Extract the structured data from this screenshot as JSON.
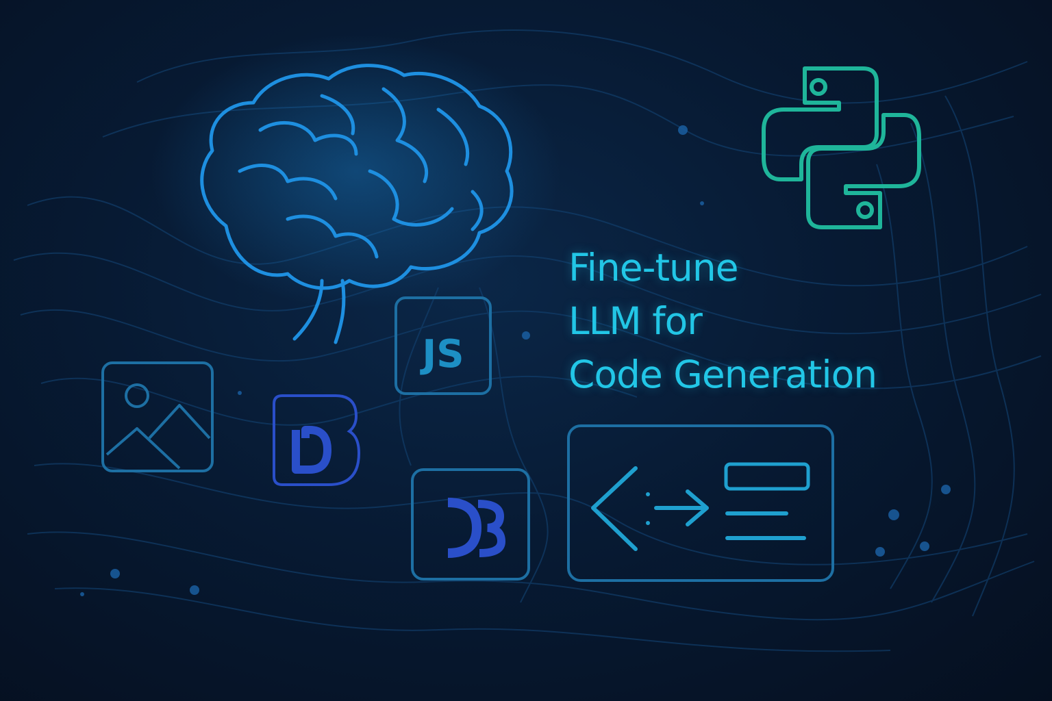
{
  "headline": {
    "line_1": "Fine-tune",
    "line_2": "LLM for",
    "line_3": "Code Generation"
  },
  "icons": {
    "brain": "brain-icon",
    "python": "python-logo-icon",
    "javascript": "javascript-icon",
    "javascript_label": "JS",
    "image": "image-icon",
    "d_logo": "d-logo-icon",
    "d3_logo": "d3-logo-icon",
    "code_panel": "code-transform-icon"
  },
  "colors": {
    "background": "#061325",
    "headline": "#22c6e6",
    "brain": "#1e8fe0",
    "python": "#1fb59a",
    "tile_outline": "#1d6fa3",
    "accent_blue": "#2a4fc9"
  }
}
